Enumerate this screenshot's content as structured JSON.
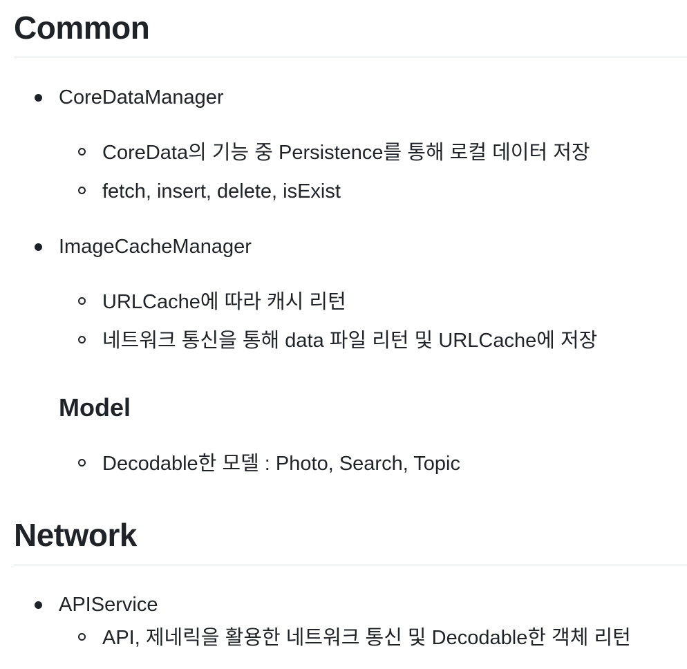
{
  "sections": {
    "common": {
      "heading": "Common",
      "items": [
        {
          "label": "CoreDataManager",
          "subitems": [
            "CoreData의 기능 중 Persistence를 통해 로컬 데이터 저장",
            "fetch, insert, delete, isExist"
          ]
        },
        {
          "label": "ImageCacheManager",
          "subitems": [
            "URLCache에 따라 캐시 리턴",
            "네트워크 통신을 통해 data 파일 리턴 및 URLCache에 저장"
          ]
        }
      ],
      "model": {
        "heading": "Model",
        "subitems": [
          "Decodable한 모델 : Photo, Search, Topic"
        ]
      }
    },
    "network": {
      "heading": "Network",
      "items": [
        {
          "label": "APIService",
          "subitems": [
            "API, 제네릭을 활용한 네트워크 통신 및 Decodable한 객체 리턴"
          ]
        }
      ]
    }
  }
}
